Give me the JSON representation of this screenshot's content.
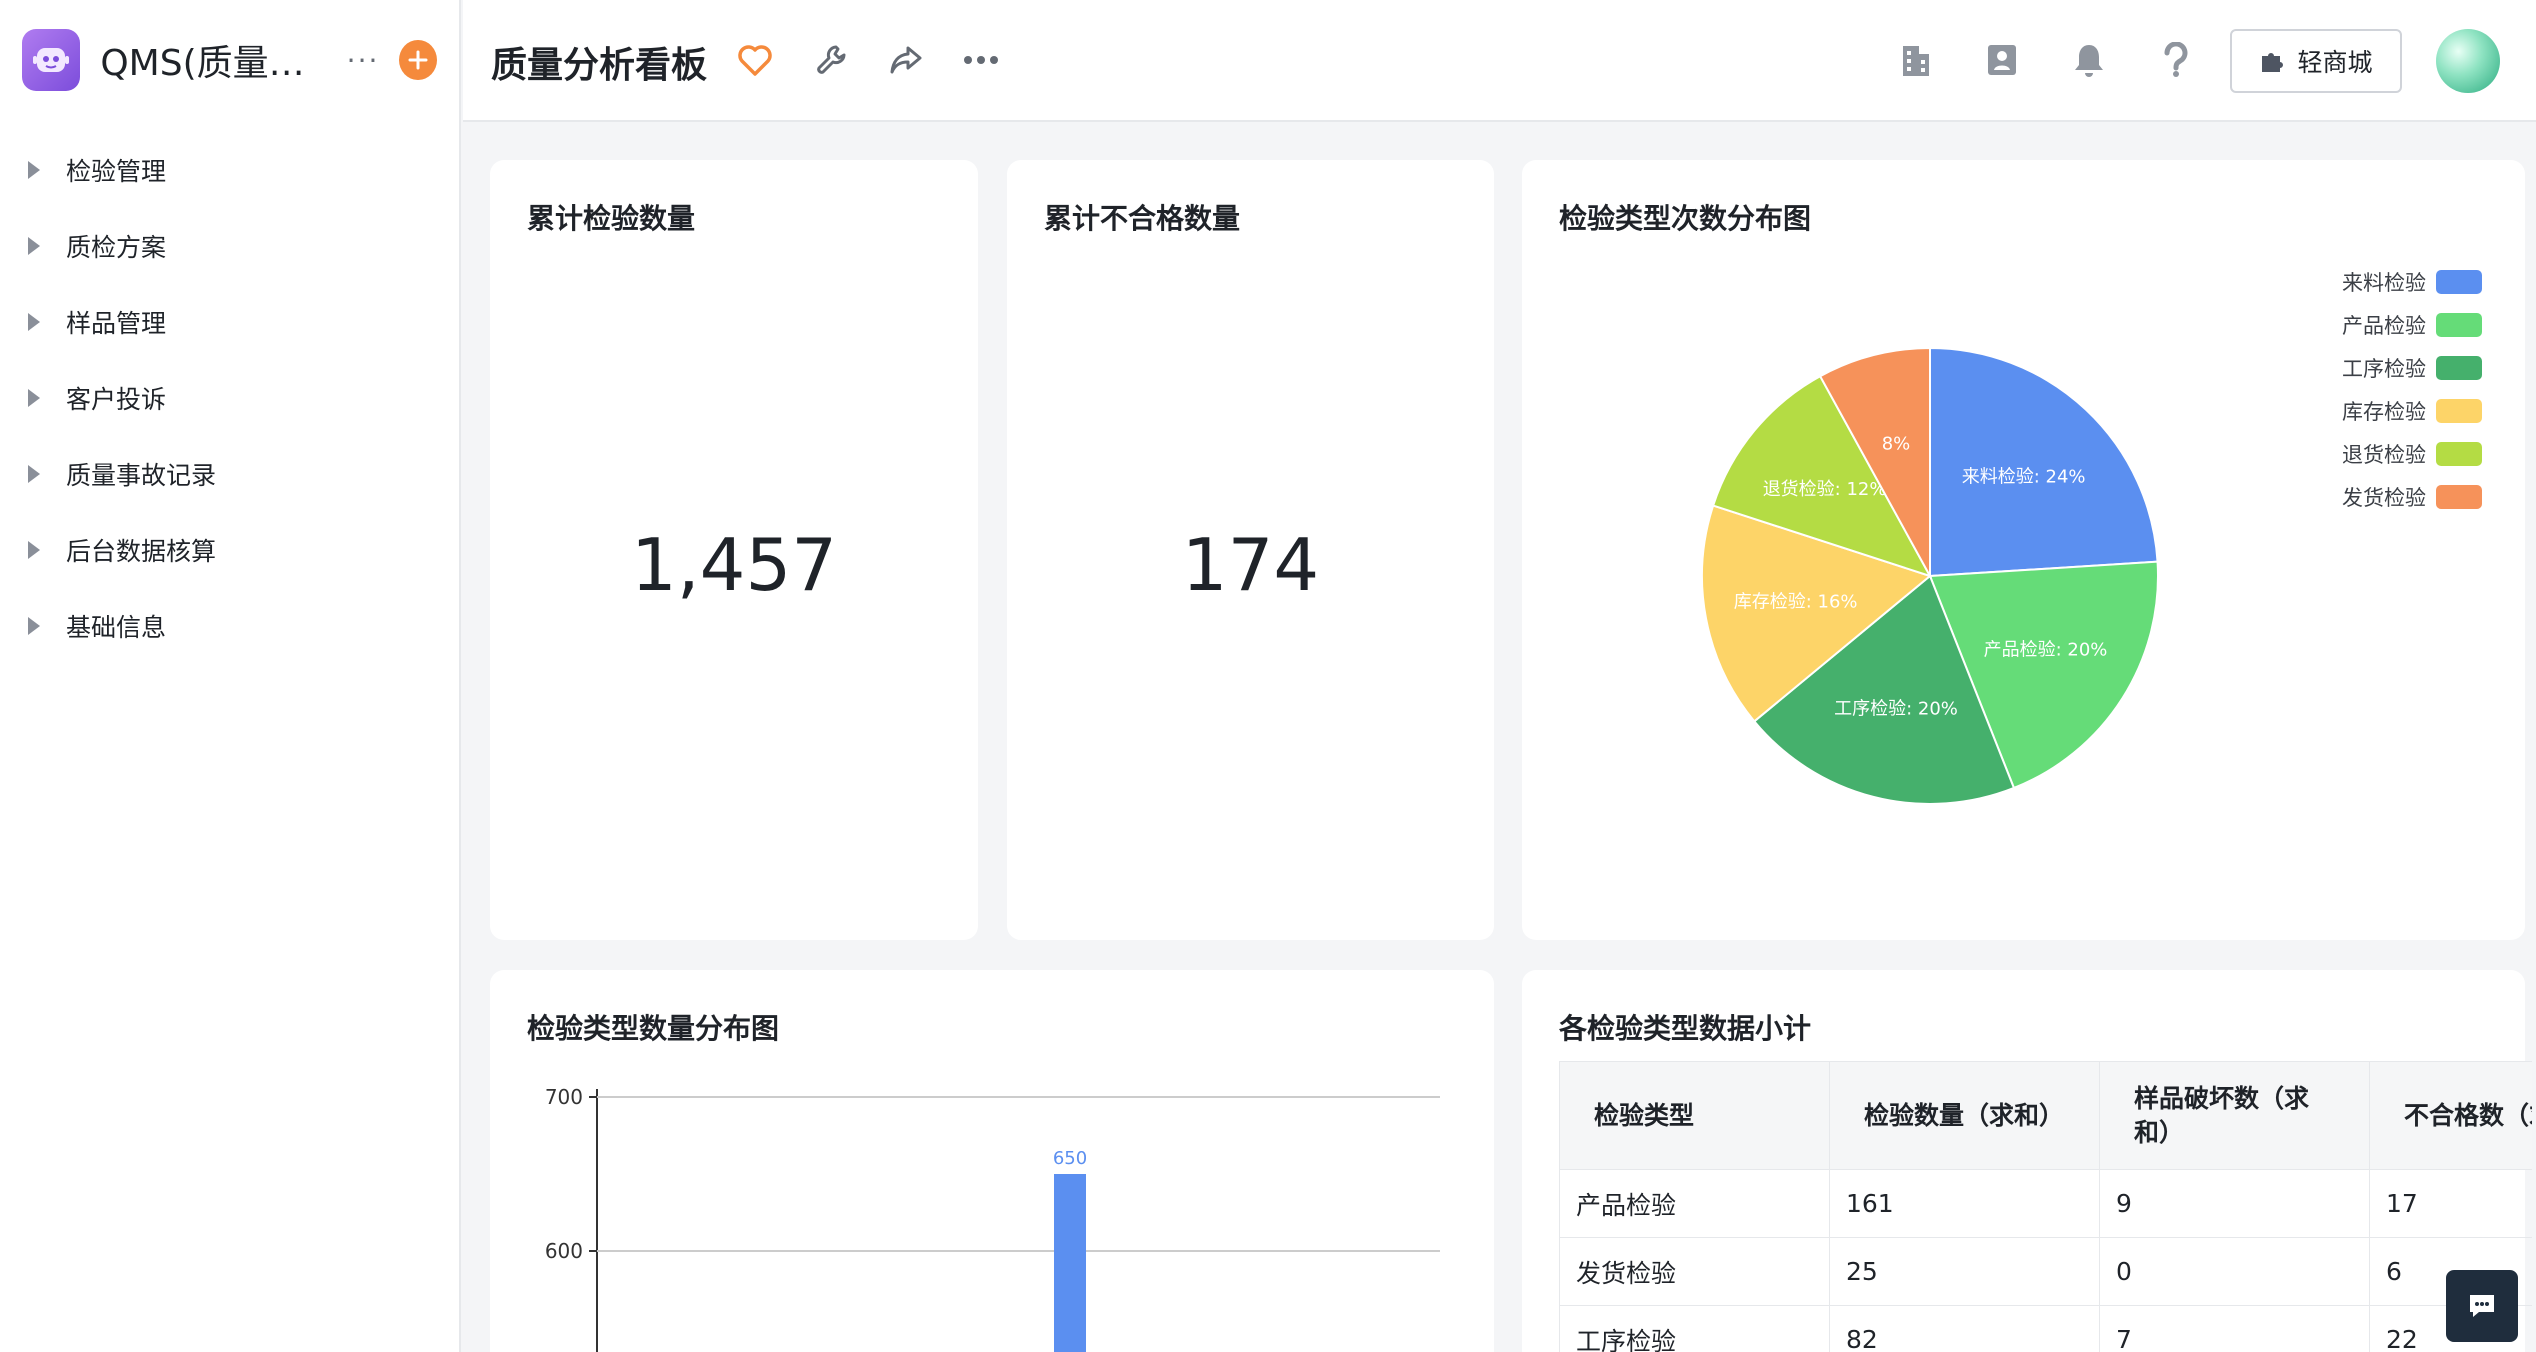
{
  "sidebar": {
    "app_title": "QMS(质量管理系统)",
    "items": [
      {
        "label": "检验管理"
      },
      {
        "label": "质检方案"
      },
      {
        "label": "样品管理"
      },
      {
        "label": "客户投诉"
      },
      {
        "label": "质量事故记录"
      },
      {
        "label": "后台数据核算"
      },
      {
        "label": "基础信息"
      }
    ]
  },
  "topbar": {
    "page_title": "质量分析看板",
    "shop_label": "轻商城"
  },
  "cards": {
    "total_inspections": {
      "title": "累计检验数量",
      "value": "1,457"
    },
    "total_unqualified": {
      "title": "累计不合格数量",
      "value": "174"
    },
    "pie_title": "检验类型次数分布图",
    "bar_title": "检验类型数量分布图",
    "table_title": "各检验类型数据小计"
  },
  "chart_data": [
    {
      "type": "pie",
      "title": "检验类型次数分布图",
      "categories": [
        "来料检验",
        "产品检验",
        "工序检验",
        "库存检验",
        "退货检验",
        "发货检验"
      ],
      "values": [
        24,
        20,
        20,
        16,
        12,
        8
      ],
      "slice_labels": [
        "来料检验: 24%",
        "产品检验: 20%",
        "工序检验: 20%",
        "库存检验: 16%",
        "退货检验: 12%",
        "8%"
      ],
      "colors": [
        "#5b8ff0",
        "#65dc78",
        "#45b06c",
        "#fdd468",
        "#b4dc44",
        "#f6925a"
      ],
      "legend": "top-right"
    },
    {
      "type": "bar",
      "title": "检验类型数量分布图",
      "y_ticks": [
        600,
        700
      ],
      "ylim_visible": [
        550,
        700
      ],
      "values": [
        650
      ],
      "data_labels": [
        "650"
      ],
      "color": "#5b8ff0",
      "grid": true
    }
  ],
  "table": {
    "headers": [
      "检验类型",
      "检验数量（求和）",
      "样品破坏数（求和）",
      "不合格数（求和）"
    ],
    "rows": [
      [
        "产品检验",
        "161",
        "9",
        "17"
      ],
      [
        "发货检验",
        "25",
        "0",
        "6"
      ],
      [
        "工序检验",
        "82",
        "7",
        "22"
      ]
    ]
  }
}
